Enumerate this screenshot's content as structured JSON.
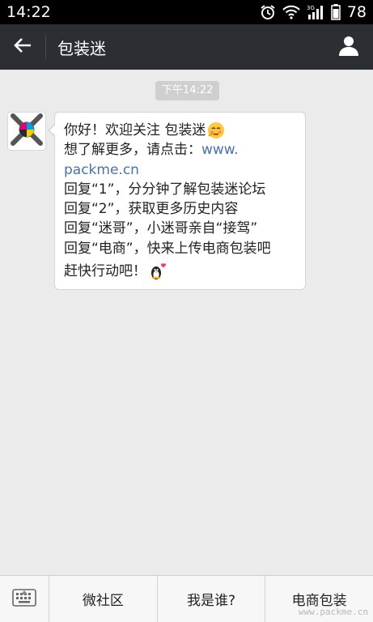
{
  "status_bar": {
    "time": "14:22",
    "battery": "78",
    "network_label": "3G",
    "icons": [
      "alarm-icon",
      "wifi-icon",
      "signal-icon",
      "battery-icon"
    ]
  },
  "header": {
    "title": "包装迷",
    "icons": [
      "back-arrow-icon",
      "profile-icon"
    ]
  },
  "chat": {
    "timestamp": "下午14:22",
    "message": {
      "lines": [
        "你好！欢迎关注 包装迷",
        "想了解更多，请点击：",
        "www.",
        "packme.cn",
        "回复“1”，分分钟了解包装迷论坛",
        "回复“2”，获取更多历史内容",
        "回复“迷哥”，小迷哥亲自“接驾”",
        "回复“电商”，快来上传电商包装吧",
        "赶快行动吧！"
      ],
      "emoji": [
        "blushing-face-icon",
        "penguin-heart-icon"
      ]
    }
  },
  "bottom_menu": {
    "items": [
      "微社区",
      "我是谁?",
      "电商包装"
    ]
  },
  "watermark": "www.packme.cn",
  "colors": {
    "status_bar": "#000000",
    "title_bar": "#2b2f33",
    "chat_bg": "#ebebeb",
    "link": "#4a73a8"
  }
}
